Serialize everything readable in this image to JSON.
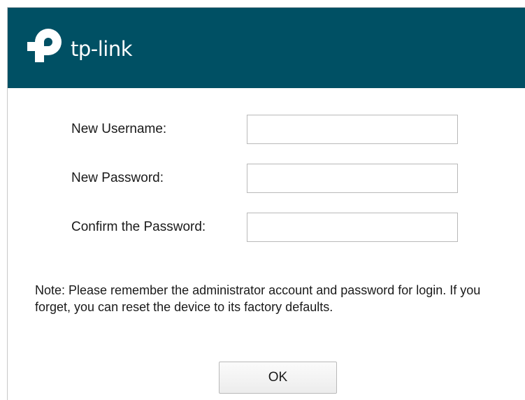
{
  "colors": {
    "brand": "#005064"
  },
  "header": {
    "logo_icon": "tp-link-logo-icon",
    "logo_text": "tp-link"
  },
  "form": {
    "username_label": "New Username:",
    "username_value": "",
    "password_label": "New Password:",
    "password_value": "",
    "confirm_label": "Confirm the Password:",
    "confirm_value": ""
  },
  "note": "Note: Please remember the administrator account and password for login. If you forget, you can reset the device to its factory defaults.",
  "ok_label": "OK"
}
